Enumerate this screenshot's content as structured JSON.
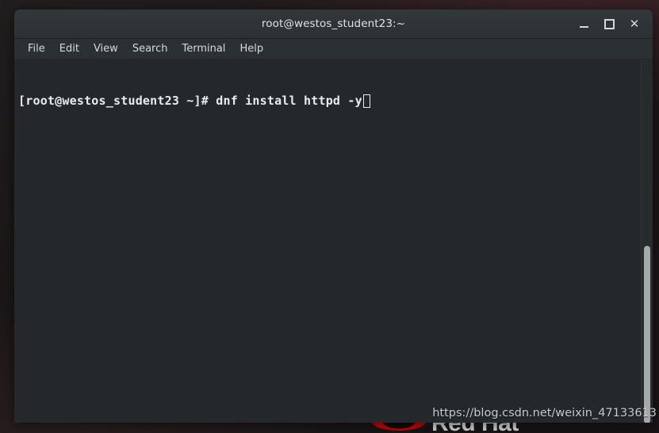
{
  "window": {
    "title": "root@westos_student23:~",
    "controls": [
      {
        "name": "minimize",
        "label": "–"
      },
      {
        "name": "maximize",
        "label": "□"
      },
      {
        "name": "close",
        "label": "✕"
      }
    ]
  },
  "menu": {
    "items": [
      {
        "label": "File"
      },
      {
        "label": "Edit"
      },
      {
        "label": "View"
      },
      {
        "label": "Search"
      },
      {
        "label": "Terminal"
      },
      {
        "label": "Help"
      }
    ]
  },
  "terminal": {
    "prompt": "[root@westos_student23 ~]# ",
    "command": "dnf install httpd -y",
    "full_line": "[root@westos_student23 ~]# dnf install httpd -y",
    "cursor": "block",
    "foreground_color": "#e9ecec",
    "background_color": "#24282b"
  },
  "scrollbar": {
    "orientation": "vertical",
    "thumb_color": "#a6a9a9"
  },
  "desktop": {
    "brand_text": "Red Hat",
    "brand_logo_color": "#cc0000"
  },
  "watermark": {
    "text": "https://blog.csdn.net/weixin_47133613"
  }
}
